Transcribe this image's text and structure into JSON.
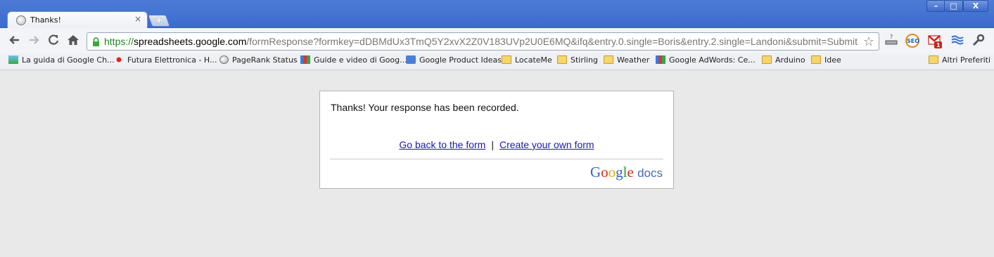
{
  "tab": {
    "title": "Thanks!",
    "close": "×",
    "new_tab": "+"
  },
  "window_controls": {
    "minimize": "–",
    "maximize": "□",
    "close": "X"
  },
  "omnibox": {
    "protocol": "https://",
    "host": "spreadsheets.google.com",
    "path": "/formResponse?formkey=dDBMdUx3TmQ5Y2xvX2Z0V183UVp2U0E6MQ&ifq&entry.0.single=Boris&entry.2.single=Landoni&submit=Submit"
  },
  "extensions": {
    "seo": "SEO",
    "gmail_count": "1"
  },
  "bookmarks": [
    {
      "label": "La guida di Google Ch...",
      "icon": "map-icon"
    },
    {
      "label": "Futura Elettronica - H...",
      "icon": "laser-icon"
    },
    {
      "label": "PageRank Status",
      "icon": "globe-icon"
    },
    {
      "label": "Guide e video di Goog...",
      "icon": "google-icon"
    },
    {
      "label": "Google Product Ideas",
      "icon": "check-icon"
    },
    {
      "label": "LocateMe",
      "icon": "folder-icon"
    },
    {
      "label": "Stirling",
      "icon": "folder-icon"
    },
    {
      "label": "Weather",
      "icon": "folder-icon"
    },
    {
      "label": "Google AdWords: Ce...",
      "icon": "google-icon"
    },
    {
      "label": "Arduino",
      "icon": "folder-icon"
    },
    {
      "label": "Idee",
      "icon": "folder-icon"
    }
  ],
  "other_bookmarks": "Altri Preferiti",
  "page": {
    "message": "Thanks! Your response has been recorded.",
    "back_link": "Go back to the form",
    "separator": "|",
    "create_link": "Create your own form",
    "logo_docs": "docs"
  }
}
